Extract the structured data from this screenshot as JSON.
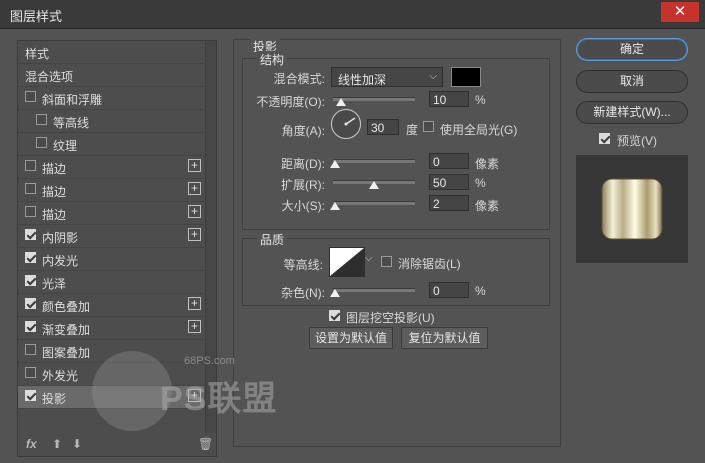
{
  "window": {
    "title": "图层样式",
    "close_glyph": "✕"
  },
  "left": {
    "items": [
      {
        "label": "样式",
        "type": "header"
      },
      {
        "label": "混合选项",
        "type": "header"
      },
      {
        "label": "斜面和浮雕",
        "checked": false,
        "plus": false,
        "indent": 0
      },
      {
        "label": "等高线",
        "checked": false,
        "plus": false,
        "indent": 1
      },
      {
        "label": "纹理",
        "checked": false,
        "plus": false,
        "indent": 1
      },
      {
        "label": "描边",
        "checked": false,
        "plus": true,
        "indent": 0
      },
      {
        "label": "描边",
        "checked": false,
        "plus": true,
        "indent": 0
      },
      {
        "label": "描边",
        "checked": false,
        "plus": true,
        "indent": 0
      },
      {
        "label": "内阴影",
        "checked": true,
        "plus": true,
        "indent": 0
      },
      {
        "label": "内发光",
        "checked": true,
        "plus": false,
        "indent": 0
      },
      {
        "label": "光泽",
        "checked": true,
        "plus": false,
        "indent": 0
      },
      {
        "label": "颜色叠加",
        "checked": true,
        "plus": true,
        "indent": 0
      },
      {
        "label": "渐变叠加",
        "checked": true,
        "plus": true,
        "indent": 0
      },
      {
        "label": "图案叠加",
        "checked": false,
        "plus": false,
        "indent": 0
      },
      {
        "label": "外发光",
        "checked": false,
        "plus": false,
        "indent": 0
      },
      {
        "label": "投影",
        "checked": true,
        "plus": true,
        "indent": 0,
        "selected": true
      }
    ],
    "footer": {
      "fx": "fx",
      "up": "⬆",
      "down": "⬇",
      "trash": "🗑"
    }
  },
  "shadow": {
    "section_title": "投影",
    "structure_title": "结构",
    "blend_label": "混合模式:",
    "blend_value": "线性加深",
    "blend_color": "#000000",
    "opacity_label": "不透明度(O):",
    "opacity_value": "10",
    "opacity_unit": "%",
    "angle_label": "角度(A):",
    "angle_value": "30",
    "angle_unit": "度",
    "global_light_label": "使用全局光(G)",
    "global_light_checked": false,
    "distance_label": "距离(D):",
    "distance_value": "0",
    "distance_unit": "像素",
    "spread_label": "扩展(R):",
    "spread_value": "50",
    "spread_unit": "%",
    "size_label": "大小(S):",
    "size_value": "2",
    "size_unit": "像素",
    "quality_title": "品质",
    "contour_label": "等高线:",
    "antialias_label": "消除锯齿(L)",
    "antialias_checked": false,
    "noise_label": "杂色(N):",
    "noise_value": "0",
    "noise_unit": "%",
    "knockout_label": "图层挖空投影(U)",
    "knockout_checked": true,
    "make_default": "设置为默认值",
    "reset_default": "复位为默认值"
  },
  "right": {
    "ok": "确定",
    "cancel": "取消",
    "new_style": "新建样式(W)...",
    "preview_label": "预览(V)",
    "preview_checked": true
  },
  "watermark": {
    "site": "68PS.com",
    "brand": "PS联盟"
  }
}
